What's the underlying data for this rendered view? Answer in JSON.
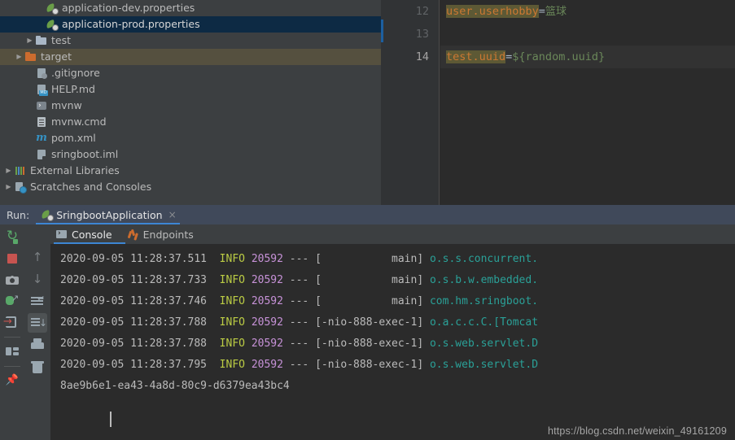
{
  "project_tree": {
    "items": [
      {
        "label": "application-dev.properties",
        "icon": "spring-leaf-icon",
        "indent": 3,
        "arrow": "none",
        "state": "normal"
      },
      {
        "label": "application-prod.properties",
        "icon": "spring-leaf-icon",
        "indent": 3,
        "arrow": "none",
        "state": "selected"
      },
      {
        "label": "test",
        "icon": "folder-icon",
        "indent": 2,
        "arrow": "collapsed",
        "state": "normal"
      },
      {
        "label": "target",
        "icon": "folder-orange-icon",
        "indent": 1,
        "arrow": "collapsed",
        "state": "highlighted"
      },
      {
        "label": ".gitignore",
        "icon": "gitignore-file-icon",
        "indent": 2,
        "arrow": "none",
        "state": "normal"
      },
      {
        "label": "HELP.md",
        "icon": "markdown-file-icon",
        "indent": 2,
        "arrow": "none",
        "state": "normal"
      },
      {
        "label": "mvnw",
        "icon": "shell-script-icon",
        "indent": 2,
        "arrow": "none",
        "state": "normal"
      },
      {
        "label": "mvnw.cmd",
        "icon": "cmd-file-icon",
        "indent": 2,
        "arrow": "none",
        "state": "normal"
      },
      {
        "label": "pom.xml",
        "icon": "maven-icon",
        "indent": 2,
        "arrow": "none",
        "state": "normal"
      },
      {
        "label": "sringboot.iml",
        "icon": "iml-file-icon",
        "indent": 2,
        "arrow": "none",
        "state": "normal"
      },
      {
        "label": "External Libraries",
        "icon": "libraries-icon",
        "indent": 0,
        "arrow": "collapsed",
        "state": "normal"
      },
      {
        "label": "Scratches and Consoles",
        "icon": "scratches-icon",
        "indent": 0,
        "arrow": "collapsed",
        "state": "normal"
      }
    ]
  },
  "editor": {
    "line_numbers": [
      "12",
      "13",
      "14"
    ],
    "current_line_index": 2,
    "lines": [
      {
        "key": "user.userhobby",
        "eq": "=",
        "value": "篮球",
        "value_kind": "cjk"
      },
      {
        "key": "",
        "eq": "",
        "value": "",
        "value_kind": "empty"
      },
      {
        "key": "test.uuid",
        "eq": "=",
        "value": "${random.uuid}",
        "value_kind": "expr"
      }
    ]
  },
  "run_window": {
    "header_label": "Run:",
    "tab_label": "SringbootApplication",
    "tab_close": "×",
    "tab_icon": "spring-run-icon",
    "toolbar_left": [
      {
        "name": "rerun-button",
        "icon": "rerun-icon"
      },
      {
        "name": "stop-button",
        "icon": "stop-icon"
      },
      {
        "name": "screenshot-button",
        "icon": "camera-icon"
      },
      {
        "name": "debug-attach-button",
        "icon": "debug-bug-icon"
      },
      {
        "name": "exit-button",
        "icon": "exit-arrow-icon"
      },
      {
        "name": "layout-button",
        "icon": "layout-icon"
      },
      {
        "name": "pin-button",
        "icon": "pin-icon"
      }
    ],
    "toolbar_right": [
      {
        "name": "up-button",
        "icon": "arrow-up-icon",
        "active": false
      },
      {
        "name": "down-button",
        "icon": "arrow-down-icon",
        "active": false
      },
      {
        "name": "soft-wrap-button",
        "icon": "soft-wrap-icon",
        "active": false
      },
      {
        "name": "scroll-to-end-button",
        "icon": "scroll-end-icon",
        "active": true
      },
      {
        "name": "print-button",
        "icon": "print-icon",
        "active": false
      },
      {
        "name": "clear-all-button",
        "icon": "trash-icon",
        "active": false
      }
    ],
    "tabs": [
      {
        "label": "Console",
        "icon": "console-icon",
        "active": true
      },
      {
        "label": "Endpoints",
        "icon": "endpoints-icon",
        "active": false
      }
    ]
  },
  "console": {
    "lines": [
      {
        "kind": "log",
        "timestamp": "2020-09-05 11:28:37.511",
        "level": "INFO",
        "pid": "20592",
        "dashes": "---",
        "thread": "[           main]",
        "logger": "o.s.s.concurrent."
      },
      {
        "kind": "log",
        "timestamp": "2020-09-05 11:28:37.733",
        "level": "INFO",
        "pid": "20592",
        "dashes": "---",
        "thread": "[           main]",
        "logger": "o.s.b.w.embedded."
      },
      {
        "kind": "log",
        "timestamp": "2020-09-05 11:28:37.746",
        "level": "INFO",
        "pid": "20592",
        "dashes": "---",
        "thread": "[           main]",
        "logger": "com.hm.sringboot."
      },
      {
        "kind": "log",
        "timestamp": "2020-09-05 11:28:37.788",
        "level": "INFO",
        "pid": "20592",
        "dashes": "---",
        "thread": "[-nio-888-exec-1]",
        "logger": "o.a.c.c.C.[Tomcat"
      },
      {
        "kind": "log",
        "timestamp": "2020-09-05 11:28:37.788",
        "level": "INFO",
        "pid": "20592",
        "dashes": "---",
        "thread": "[-nio-888-exec-1]",
        "logger": "o.s.web.servlet.D"
      },
      {
        "kind": "log",
        "timestamp": "2020-09-05 11:28:37.795",
        "level": "INFO",
        "pid": "20592",
        "dashes": "---",
        "thread": "[-nio-888-exec-1]",
        "logger": "o.s.web.servlet.D"
      },
      {
        "kind": "plain",
        "text": "8ae9b6e1-ea43-4a8d-80c9-d6379ea43bc4"
      }
    ],
    "watermark": "https://blog.csdn.net/weixin_49161209"
  },
  "colors": {
    "panel_bg": "#3c3f41",
    "editor_bg": "#2b2b2b",
    "gutter_bg": "#313335",
    "selection_bg": "#0d2a44",
    "highlight_bg": "#55503f",
    "prop_key_bg": "#5d5935",
    "prop_key_fg": "#cc7832",
    "prop_value_fg": "#6a8759",
    "accent_blue": "#3d86d4",
    "run_header_bg": "#40495a",
    "log_info": "#bbcc44",
    "log_pid": "#c792d8",
    "log_logger": "#2aa198"
  }
}
